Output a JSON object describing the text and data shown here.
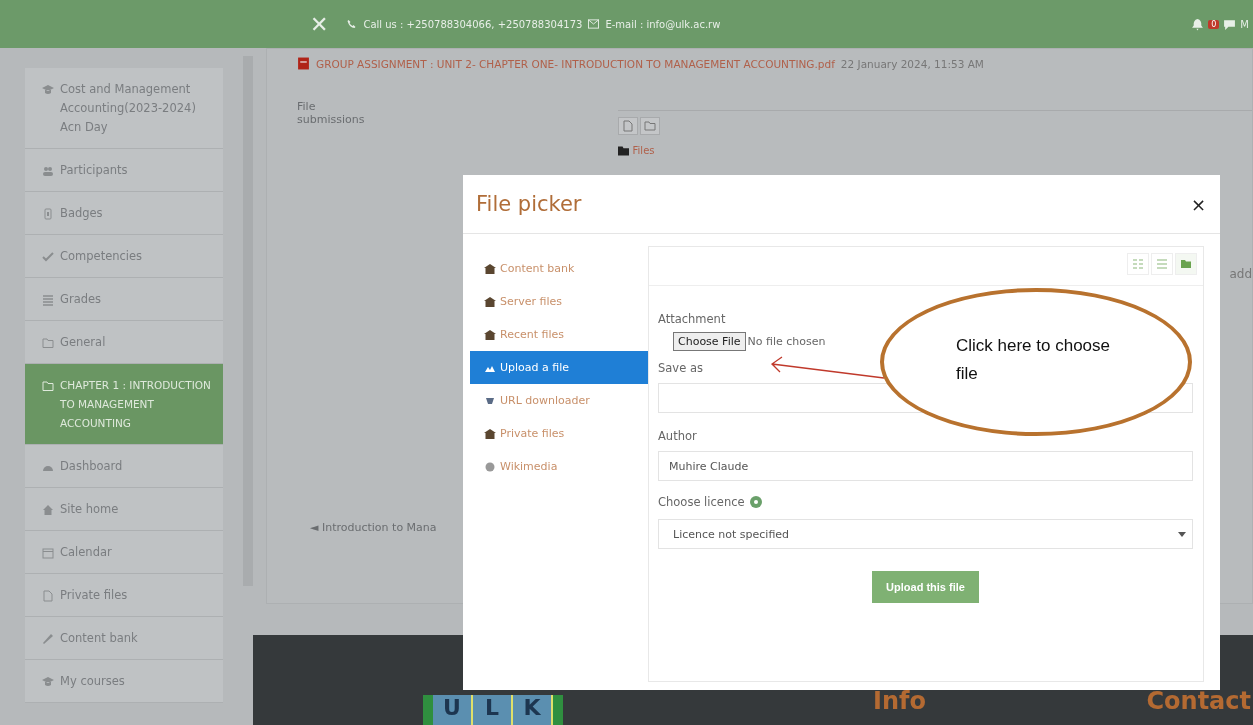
{
  "header": {
    "close_glyph": "✕",
    "contact": "Call us : +250788304066, +250788304173",
    "email": "E-mail : info@ulk.ac.rw",
    "notification_count": "0",
    "user": "M"
  },
  "sidebar": {
    "items": [
      {
        "label": "Cost and Management Accounting(2023-2024) Acn Day",
        "selected": false
      },
      {
        "label": "Participants",
        "selected": false
      },
      {
        "label": "Badges",
        "selected": false
      },
      {
        "label": "Competencies",
        "selected": false
      },
      {
        "label": "Grades",
        "selected": false
      },
      {
        "label": "General",
        "selected": false
      },
      {
        "label": "CHAPTER 1 : INTRODUCTION TO MANAGEMENT ACCOUNTING",
        "selected": true
      },
      {
        "label": "Dashboard",
        "selected": false
      },
      {
        "label": "Site home",
        "selected": false
      },
      {
        "label": "Calendar",
        "selected": false
      },
      {
        "label": "Private files",
        "selected": false
      },
      {
        "label": "Content bank",
        "selected": false
      },
      {
        "label": "My courses",
        "selected": false
      }
    ]
  },
  "main": {
    "attachment_link": "GROUP ASSIGNMENT : UNIT 2- CHAPTER ONE- INTRODUCTION TO MANAGEMENT ACCOUNTING.pdf",
    "attachment_date": "22 January 2024, 11:53 AM",
    "file_submissions_label": "File submissions",
    "files_folder": "Files",
    "add_text": "add",
    "prev_link": "◄ Introduction to Mana"
  },
  "footer": {
    "logo_letters": [
      "U",
      "L",
      "K"
    ],
    "info_heading": "Info",
    "contact_heading": "Contact"
  },
  "dialog": {
    "title": "File picker",
    "close": "×",
    "repositories": [
      {
        "label": "Content bank",
        "selected": false
      },
      {
        "label": "Server files",
        "selected": false
      },
      {
        "label": "Recent files",
        "selected": false
      },
      {
        "label": "Upload a file",
        "selected": true
      },
      {
        "label": "URL downloader",
        "selected": false
      },
      {
        "label": "Private files",
        "selected": false
      },
      {
        "label": "Wikimedia",
        "selected": false
      }
    ],
    "views": [
      {
        "kind": "icons",
        "selected": false
      },
      {
        "kind": "list",
        "selected": false
      },
      {
        "kind": "tree",
        "selected": true
      }
    ],
    "attachment_label": "Attachment",
    "choose_file_button": "Choose File",
    "no_file_text": "No file chosen",
    "save_as_label": "Save as",
    "author_label": "Author",
    "author_value": "Muhire Claude",
    "licence_label": "Choose licence",
    "licence_value": "Licence not specified",
    "upload_button": "Upload this file"
  },
  "annotation": {
    "callout_text": "Click here to choose file"
  }
}
